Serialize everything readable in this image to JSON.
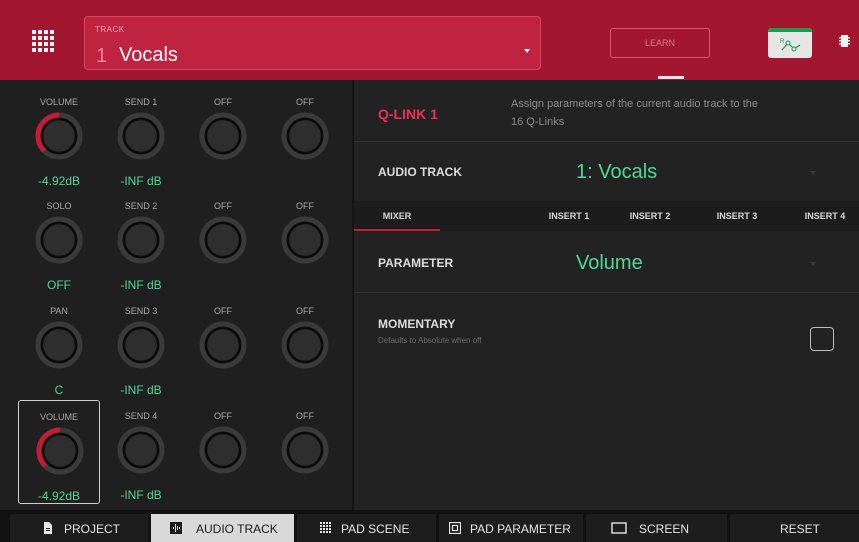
{
  "header": {
    "track_caption": "TRACK",
    "track_number": "1",
    "track_name": "Vocals",
    "learn_label": "LEARN",
    "link_icon_letter": "R"
  },
  "knobs": [
    {
      "title": "VOLUME",
      "value": "-4.92dB",
      "level": 0.5
    },
    {
      "title": "SEND 1",
      "value": "-INF dB",
      "level": 0
    },
    {
      "title": "OFF",
      "value": "",
      "level": 0
    },
    {
      "title": "OFF",
      "value": "",
      "level": 0
    },
    {
      "title": "SOLO",
      "value": "OFF",
      "level": 0
    },
    {
      "title": "SEND 2",
      "value": "-INF dB",
      "level": 0
    },
    {
      "title": "OFF",
      "value": "",
      "level": 0
    },
    {
      "title": "OFF",
      "value": "",
      "level": 0
    },
    {
      "title": "PAN",
      "value": "C",
      "level": 0
    },
    {
      "title": "SEND 3",
      "value": "-INF dB",
      "level": 0
    },
    {
      "title": "OFF",
      "value": "",
      "level": 0
    },
    {
      "title": "OFF",
      "value": "",
      "level": 0
    },
    {
      "title": "VOLUME",
      "value": "-4.92dB",
      "level": 0.5,
      "active": true
    },
    {
      "title": "SEND 4",
      "value": "-INF dB",
      "level": 0
    },
    {
      "title": "OFF",
      "value": "",
      "level": 0
    },
    {
      "title": "OFF",
      "value": "",
      "level": 0
    }
  ],
  "panel": {
    "qlink_title": "Q-LINK 1",
    "qlink_description": "Assign parameters of the current audio track to the 16 Q-Links",
    "audio_track_label": "AUDIO TRACK",
    "audio_track_value": "1: Vocals",
    "tabs": [
      {
        "label": "MIXER",
        "active": true
      },
      {
        "label": "INSERT 1",
        "active": false
      },
      {
        "label": "INSERT 2",
        "active": false
      },
      {
        "label": "INSERT 3",
        "active": false
      },
      {
        "label": "INSERT 4",
        "active": false
      }
    ],
    "parameter_label": "PARAMETER",
    "parameter_value": "Volume",
    "momentary_label": "MOMENTARY",
    "momentary_sub": "Defaults to Absolute when off",
    "momentary_checked": false
  },
  "nav": [
    {
      "label": "PROJECT",
      "icon": "document-icon",
      "active": false
    },
    {
      "label": "AUDIO TRACK",
      "icon": "waveform-icon",
      "active": true
    },
    {
      "label": "PAD SCENE",
      "icon": "pad-grid-icon",
      "active": false
    },
    {
      "label": "PAD PARAMETER",
      "icon": "pad-icon",
      "active": false
    },
    {
      "label": "SCREEN",
      "icon": "screen-icon",
      "active": false
    },
    {
      "label": "RESET",
      "icon": "",
      "active": false
    }
  ],
  "colors": {
    "header_bg": "#a3162f",
    "accent_red": "#c41c36",
    "qlink_red": "#ec2f56",
    "value_green": "#54d69a",
    "link_green": "#1b9c55"
  }
}
